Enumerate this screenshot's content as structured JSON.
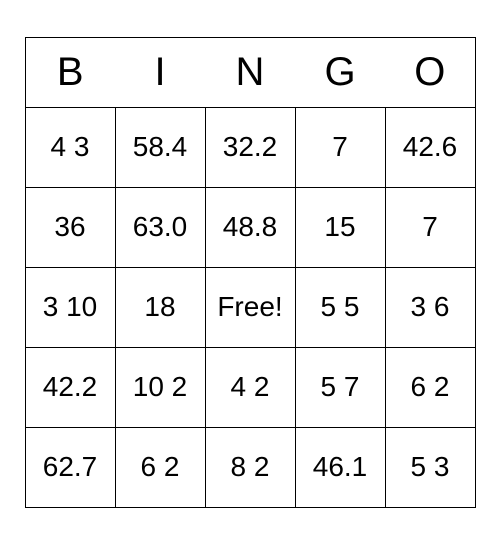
{
  "headers": [
    "B",
    "I",
    "N",
    "G",
    "O"
  ],
  "grid": [
    [
      "4 3",
      "58.4",
      "32.2",
      "7",
      "42.6"
    ],
    [
      "36",
      "63.0",
      "48.8",
      "15",
      "7"
    ],
    [
      "3 10",
      "18",
      "Free!",
      "5 5",
      "3 6"
    ],
    [
      "42.2",
      "10 2",
      "4 2",
      "5 7",
      "6 2"
    ],
    [
      "62.7",
      "6 2",
      "8 2",
      "46.1",
      "5 3"
    ]
  ]
}
